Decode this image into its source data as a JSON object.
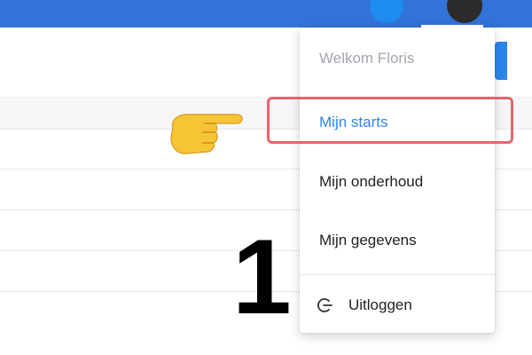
{
  "menu": {
    "welcome": "Welkom Floris",
    "items": [
      {
        "label": "Mijn starts",
        "active": true
      },
      {
        "label": "Mijn onderhoud"
      },
      {
        "label": "Mijn gegevens"
      }
    ],
    "logout": {
      "label": "Uitloggen",
      "icon": "logout-icon"
    }
  },
  "annotation": {
    "step_number": "1",
    "pointer_icon": "pointing-hand-icon",
    "highlight_color": "#e8636b"
  },
  "colors": {
    "topbar": "#3173d6",
    "accent": "#2f86e6"
  }
}
